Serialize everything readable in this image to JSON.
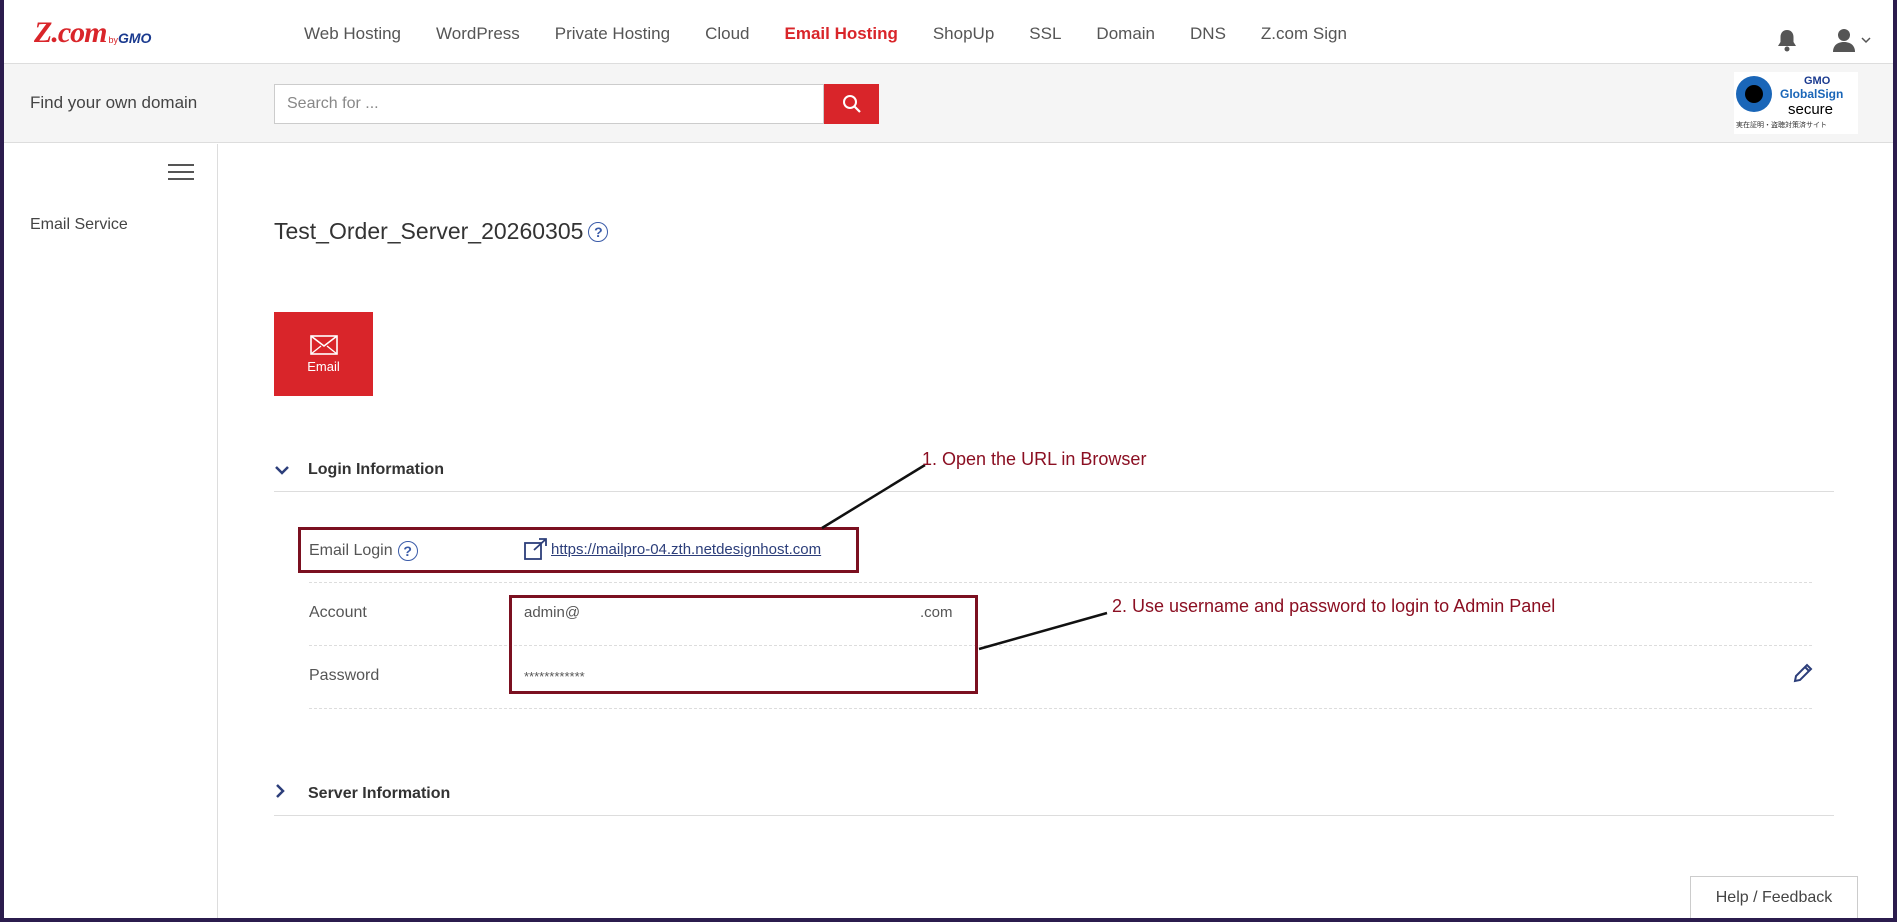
{
  "brand": {
    "logo_main": "Z.com",
    "logo_by": "by",
    "logo_gmo": "GMO"
  },
  "nav": {
    "items": [
      {
        "label": "Web Hosting"
      },
      {
        "label": "WordPress"
      },
      {
        "label": "Private Hosting"
      },
      {
        "label": "Cloud"
      },
      {
        "label": "Email Hosting",
        "active": true
      },
      {
        "label": "ShopUp"
      },
      {
        "label": "SSL"
      },
      {
        "label": "Domain"
      },
      {
        "label": "DNS"
      },
      {
        "label": "Z.com Sign"
      }
    ],
    "icons": [
      "bell-icon",
      "user-icon",
      "chevron-down-icon"
    ]
  },
  "search": {
    "label": "Find your own domain",
    "placeholder": "Search for ..."
  },
  "badge": {
    "gmo": "GMO",
    "globalsign": "GlobalSign",
    "secure": "secure",
    "jp_text": "実在証明・盗聴対策済サイト"
  },
  "sidebar": {
    "items": [
      {
        "label": "Email Service"
      }
    ]
  },
  "main": {
    "title": "Test_Order_Server_20260305",
    "tile_label": "Email",
    "login_section": {
      "heading": "Login Information",
      "email_login_label": "Email Login",
      "email_login_url": "https://mailpro-04.zth.netdesignhost.com",
      "account_label": "Account",
      "account_prefix": "admin@",
      "account_suffix": ".com",
      "password_label": "Password",
      "password_value": "************"
    },
    "server_section": {
      "heading": "Server Information"
    }
  },
  "annotations": {
    "step1": "1. Open the URL in Browser",
    "step2": "2. Use username and password to login to Admin Panel",
    "color": "#8b0f22"
  },
  "help_feedback": "Help / Feedback",
  "colors": {
    "brand_red": "#d9252a",
    "link_blue": "#2c3e7a"
  }
}
